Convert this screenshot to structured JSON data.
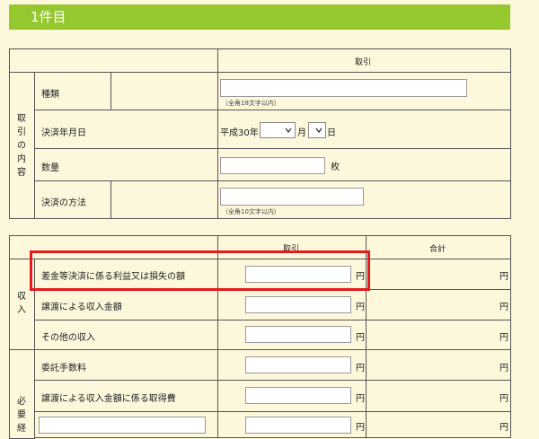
{
  "header": {
    "title": "1件目"
  },
  "table1": {
    "col_header": "取引",
    "side_label": [
      "取",
      "引",
      "の",
      "内",
      "容"
    ],
    "rows": {
      "kind": {
        "label": "種類",
        "hint": "（全角18文字以内）"
      },
      "date": {
        "label": "決済年月日",
        "era": "平成30年",
        "month": "月",
        "day": "日"
      },
      "qty": {
        "label": "数量",
        "unit": "枚"
      },
      "method": {
        "label": "決済の方法",
        "hint": "（全角10文字以内）"
      }
    }
  },
  "table2": {
    "col_header_1": "取引",
    "col_header_2": "合計",
    "side_income": [
      "収",
      "入"
    ],
    "side_expense": [
      "必",
      "要",
      "経"
    ],
    "yen": "円",
    "rows": [
      {
        "label": "差金等決済に係る利益又は損失の額"
      },
      {
        "label": "譲渡による収入金額"
      },
      {
        "label": "その他の収入"
      },
      {
        "label": "委託手数料"
      },
      {
        "label": "譲渡による収入金額に係る取得費"
      },
      {
        "label": ""
      }
    ]
  }
}
